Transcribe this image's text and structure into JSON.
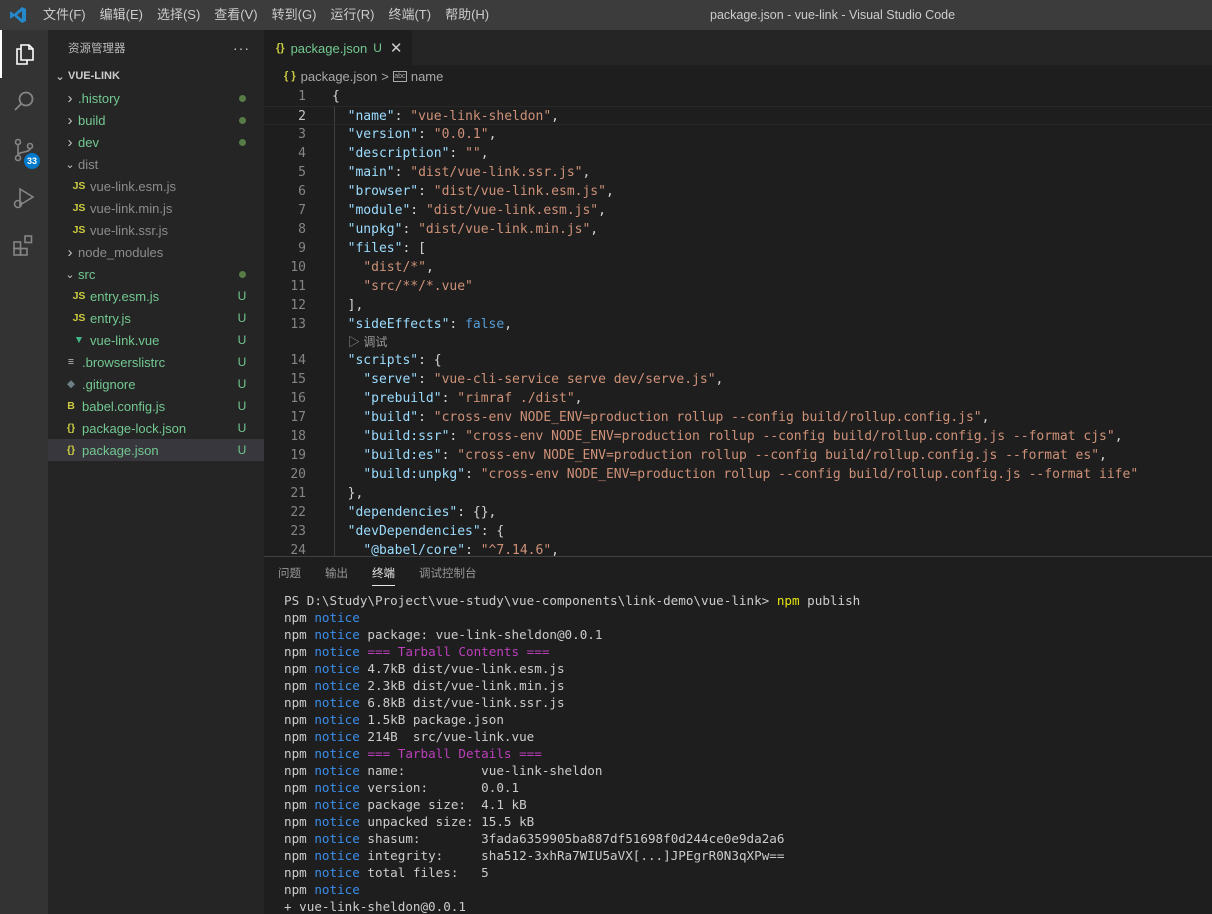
{
  "titlebar": {
    "menus": [
      "文件(F)",
      "编辑(E)",
      "选择(S)",
      "查看(V)",
      "转到(G)",
      "运行(R)",
      "终端(T)",
      "帮助(H)"
    ],
    "window_title": "package.json - vue-link - Visual Studio Code"
  },
  "activitybar": {
    "icons": [
      "explorer-icon",
      "search-icon",
      "source-control-icon",
      "run-debug-icon",
      "extensions-icon"
    ],
    "scm_badge": "33"
  },
  "sidebar": {
    "title": "资源管理器",
    "more": "···",
    "project": "VUE-LINK",
    "items": [
      {
        "label": ".history",
        "type": "folder",
        "expanded": false,
        "status": "dot",
        "color": "#73c991",
        "depth": 0
      },
      {
        "label": "build",
        "type": "folder",
        "expanded": false,
        "status": "dot",
        "color": "#73c991",
        "depth": 0
      },
      {
        "label": "dev",
        "type": "folder",
        "expanded": false,
        "status": "dot",
        "color": "#73c991",
        "depth": 0
      },
      {
        "label": "dist",
        "type": "folder",
        "expanded": true,
        "status": "",
        "color": "#8c8c8c",
        "depth": 0
      },
      {
        "label": "vue-link.esm.js",
        "type": "js",
        "status": "",
        "color": "#8c8c8c",
        "depth": 1
      },
      {
        "label": "vue-link.min.js",
        "type": "js",
        "status": "",
        "color": "#8c8c8c",
        "depth": 1
      },
      {
        "label": "vue-link.ssr.js",
        "type": "js",
        "status": "",
        "color": "#8c8c8c",
        "depth": 1
      },
      {
        "label": "node_modules",
        "type": "folder",
        "expanded": false,
        "status": "",
        "color": "#8c8c8c",
        "depth": 0
      },
      {
        "label": "src",
        "type": "folder",
        "expanded": true,
        "status": "dot",
        "color": "#73c991",
        "depth": 0
      },
      {
        "label": "entry.esm.js",
        "type": "js",
        "status": "U",
        "color": "#73c991",
        "depth": 1
      },
      {
        "label": "entry.js",
        "type": "js",
        "status": "U",
        "color": "#73c991",
        "depth": 1
      },
      {
        "label": "vue-link.vue",
        "type": "vue",
        "status": "U",
        "color": "#73c991",
        "depth": 1
      },
      {
        "label": ".browserslistrc",
        "type": "config",
        "status": "U",
        "color": "#73c991",
        "depth": 0
      },
      {
        "label": ".gitignore",
        "type": "git",
        "status": "U",
        "color": "#73c991",
        "depth": 0
      },
      {
        "label": "babel.config.js",
        "type": "babel",
        "status": "U",
        "color": "#73c991",
        "depth": 0
      },
      {
        "label": "package-lock.json",
        "type": "json",
        "status": "U",
        "color": "#73c991",
        "depth": 0
      },
      {
        "label": "package.json",
        "type": "json",
        "status": "U",
        "color": "#73c991",
        "depth": 0,
        "selected": true
      }
    ]
  },
  "editor": {
    "tab": {
      "icon": "{}",
      "label": "package.json",
      "status": "U",
      "close": "✕"
    },
    "breadcrumb": {
      "file": "package.json",
      "sep": ">",
      "symbol": "name"
    },
    "codelens": "▷ 调试",
    "line_numbers": [
      "1",
      "2",
      "3",
      "4",
      "5",
      "6",
      "7",
      "8",
      "9",
      "10",
      "11",
      "12",
      "13",
      "14",
      "15",
      "16",
      "17",
      "18",
      "19",
      "20",
      "21",
      "22",
      "23",
      "24"
    ]
  },
  "panel": {
    "tabs": [
      "问题",
      "输出",
      "终端",
      "调试控制台"
    ],
    "active_tab": "终端",
    "prompt": "PS D:\\Study\\Project\\vue-study\\vue-components\\link-demo\\vue-link> ",
    "command": "npm",
    "command_args": " publish",
    "npm": "npm",
    "notice": "notice",
    "lines": [
      {
        "kind": "notice",
        "text": ""
      },
      {
        "kind": "notice",
        "text": " package: vue-link-sheldon@0.0.1"
      },
      {
        "kind": "magenta",
        "text": " === Tarball Contents ==="
      },
      {
        "kind": "notice",
        "text": " 4.7kB dist/vue-link.esm.js"
      },
      {
        "kind": "notice",
        "text": " 2.3kB dist/vue-link.min.js"
      },
      {
        "kind": "notice",
        "text": " 6.8kB dist/vue-link.ssr.js"
      },
      {
        "kind": "notice",
        "text": " 1.5kB package.json"
      },
      {
        "kind": "notice",
        "text": " 214B  src/vue-link.vue"
      },
      {
        "kind": "magenta",
        "text": " === Tarball Details ==="
      },
      {
        "kind": "notice",
        "text": " name:          vue-link-sheldon"
      },
      {
        "kind": "notice",
        "text": " version:       0.0.1"
      },
      {
        "kind": "notice",
        "text": " package size:  4.1 kB"
      },
      {
        "kind": "notice",
        "text": " unpacked size: 15.5 kB"
      },
      {
        "kind": "notice",
        "text": " shasum:        3fada6359905ba887df51698f0d244ce0e9da2a6"
      },
      {
        "kind": "notice",
        "text": " integrity:     sha512-3xhRa7WIU5aVX[...]JPEgrR0N3qXPw=="
      },
      {
        "kind": "notice",
        "text": " total files:   5"
      },
      {
        "kind": "notice",
        "text": ""
      },
      {
        "kind": "plain",
        "text": "+ vue-link-sheldon@0.0.1"
      }
    ]
  }
}
